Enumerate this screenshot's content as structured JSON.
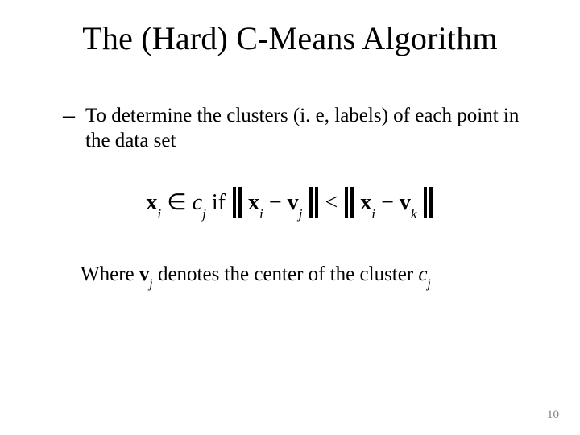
{
  "title": "The (Hard) C-Means Algorithm",
  "bullet": {
    "dash": "–",
    "text": "To determine the clusters (i. e, labels) of each point in the data set"
  },
  "formula": {
    "x": "x",
    "x_sub": "i",
    "member": "∈",
    "c": "c",
    "c_sub1": "j",
    "if": " if ",
    "v": "v",
    "v_sub1": "j",
    "lt": "<",
    "v_sub2": "k",
    "minus": "−"
  },
  "where": {
    "prefix": "Where ",
    "v": "v",
    "v_sub": "j",
    "mid": " denotes the center of the cluster ",
    "c": "c",
    "c_sub": "j"
  },
  "page_number": "10"
}
